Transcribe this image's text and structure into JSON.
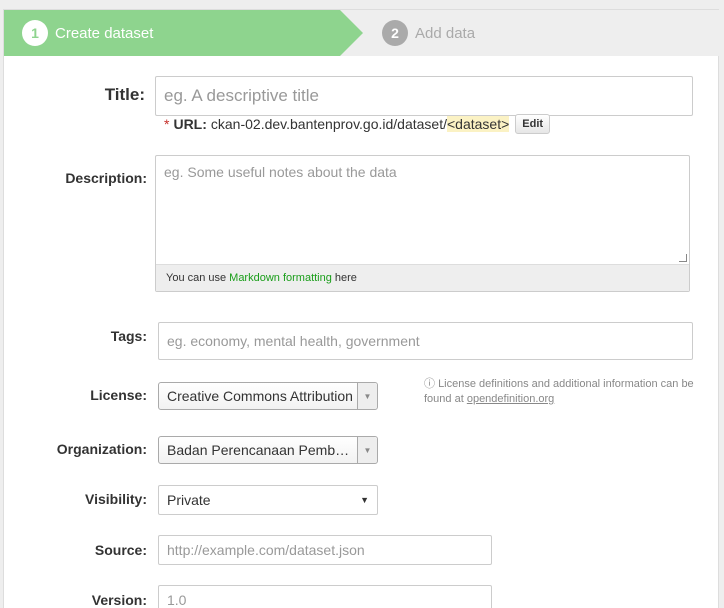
{
  "stages": {
    "current": {
      "number": "1",
      "label": "Create dataset"
    },
    "next": {
      "number": "2",
      "label": "Add data"
    }
  },
  "form": {
    "title": {
      "label": "Title:",
      "placeholder": "eg. A descriptive title"
    },
    "url": {
      "star": "*",
      "label": "URL:",
      "prefix": "ckan-02.dev.bantenprov.go.id/dataset/",
      "slug": "<dataset>",
      "edit_label": "Edit"
    },
    "description": {
      "label": "Description:",
      "placeholder": "eg. Some useful notes about the data",
      "info_before": "You can use",
      "info_link": "Markdown formatting",
      "info_after": "here"
    },
    "tags": {
      "label": "Tags:",
      "placeholder": "eg. economy, mental health, government"
    },
    "license": {
      "label": "License:",
      "value": "Creative Commons Attribution",
      "info_text": "License definitions and additional information can be found at",
      "info_link": "opendefinition.org"
    },
    "organization": {
      "label": "Organization:",
      "value": "Badan Perencanaan Pembangunan Daerah"
    },
    "visibility": {
      "label": "Visibility:",
      "value": "Private"
    },
    "source": {
      "label": "Source:",
      "placeholder": "http://example.com/dataset.json"
    },
    "version": {
      "label": "Version:",
      "placeholder": "1.0"
    }
  },
  "colors": {
    "accent": "#8ed48e",
    "link": "#1a9e1a",
    "required": "#c6302b"
  }
}
